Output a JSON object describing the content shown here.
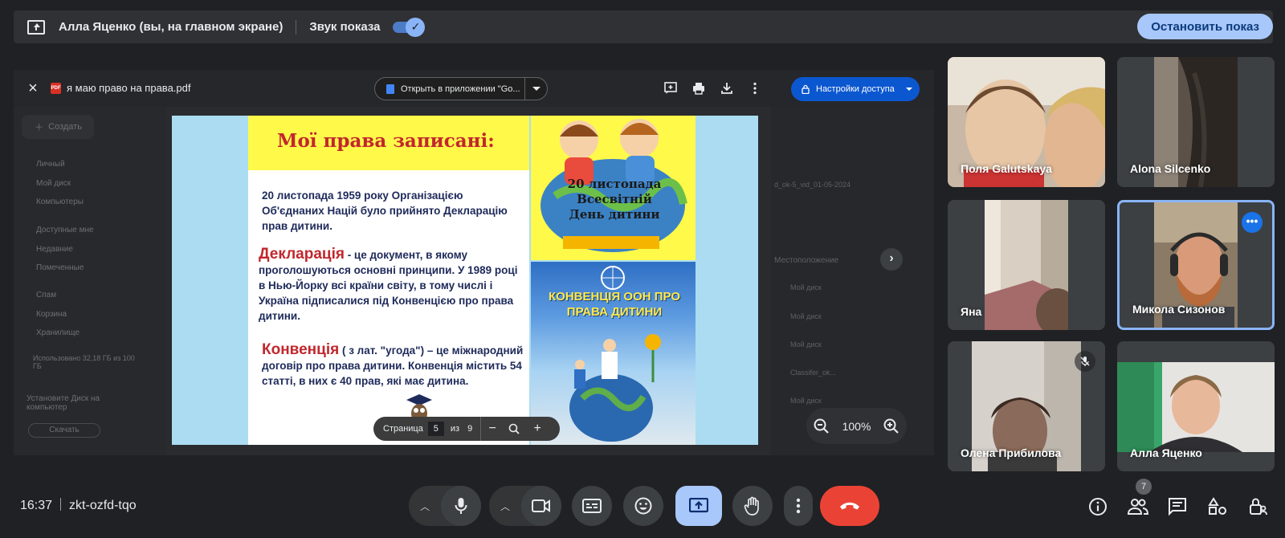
{
  "top_bar": {
    "presenter_label": "Алла Яценко (вы, на главном экране)",
    "sound_label": "Звук показа",
    "sound_on": true,
    "stop_button": "Остановить показ"
  },
  "pdf_viewer": {
    "file_name": "я маю право на права.pdf",
    "file_icon_text": "PDF",
    "open_in_label": "Открыть в приложении \"Go...",
    "access_button": "Настройки доступа",
    "page_label": "Страница",
    "page_current": "5",
    "page_of": "из",
    "page_total": "9",
    "zoom_level": "100%"
  },
  "drive_background": {
    "create_label": "Создать",
    "sidebar_items": [
      "Личный",
      "Мой диск",
      "Компьютеры",
      "Доступные мне",
      "Недавние",
      "Помеченные",
      "Спам",
      "Корзина",
      "Хранилище"
    ],
    "storage_text": "Использовано 32,18 ГБ из 100 ГБ",
    "install_text": "Установите Диск на компьютер",
    "download_label": "Скачать",
    "doc_title": "d_ok-5_vid_01-05-2024",
    "location_header": "Местоположение",
    "rows": [
      "Мой диск",
      "Мой диск",
      "Мой диск",
      "Classifer_ok...",
      "Мой диск"
    ]
  },
  "slide": {
    "title": "Мої права записані:",
    "para1": "20 листопада 1959 року Організацією Об'єднаних Націй було прийнято Декларацію прав дитини.",
    "decl_word": "Декларація",
    "para2": " - це документ, в якому проголошуються основні принципи. У 1989 році в Нью-Йорку всі країни світу, в тому числі і Україна підписалися під Конвенцією про права дитини.",
    "conv_word": "Конвенція",
    "para3": "  ( з лат. \"угода\") – це міжнародний договір про права дитини. Конвенція містить 54 статті, в них є 40 прав, які має дитина.",
    "pic1_text": "20 листопада Всесвітній День дитини",
    "pic2_text": "КОНВЕНЦІЯ ООН ПРО ПРАВА ДИТИНИ"
  },
  "participants": [
    {
      "name": "Поля Galutskaya",
      "active": false,
      "muted": false
    },
    {
      "name": "Alona Silcenko",
      "active": false,
      "muted": false
    },
    {
      "name": "Яна",
      "active": false,
      "muted": false
    },
    {
      "name": "Микола Сизонов",
      "active": true,
      "muted": false
    },
    {
      "name": "Олена Прибилова",
      "active": false,
      "muted": true
    },
    {
      "name": "Алла Яценко",
      "active": false,
      "muted": false
    }
  ],
  "bottom_bar": {
    "time": "16:37",
    "meeting_code": "zkt-ozfd-tqo",
    "participant_count": "7"
  },
  "colors": {
    "background": "#202124",
    "accent": "#8ab4f8",
    "end_call": "#ea4335",
    "present_active": "#a8c7fa"
  }
}
